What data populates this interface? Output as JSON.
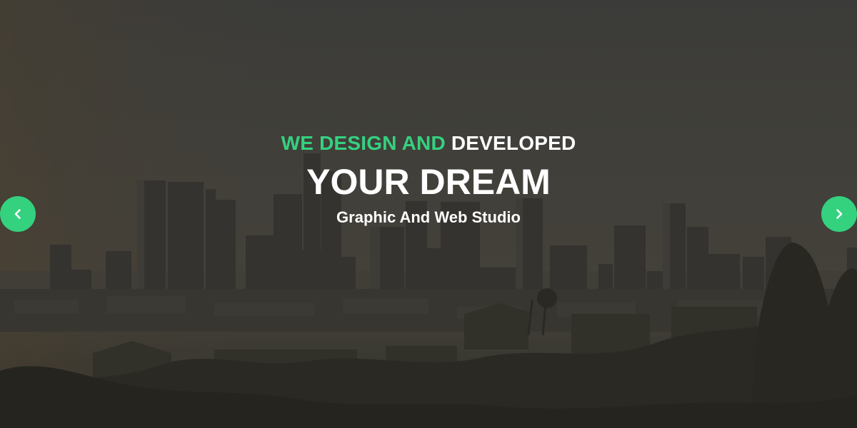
{
  "slider": {
    "headline_accent": "WE DESIGN AND",
    "headline_rest": "DEVELOPED",
    "title": "YOUR DREAM",
    "subtitle": "Graphic And Web Studio"
  },
  "navigation": {
    "prev_icon": "chevron-left-icon",
    "next_icon": "chevron-right-icon"
  },
  "colors": {
    "accent": "#34d17f",
    "text": "#ffffff",
    "overlay": "#3f3d38"
  }
}
